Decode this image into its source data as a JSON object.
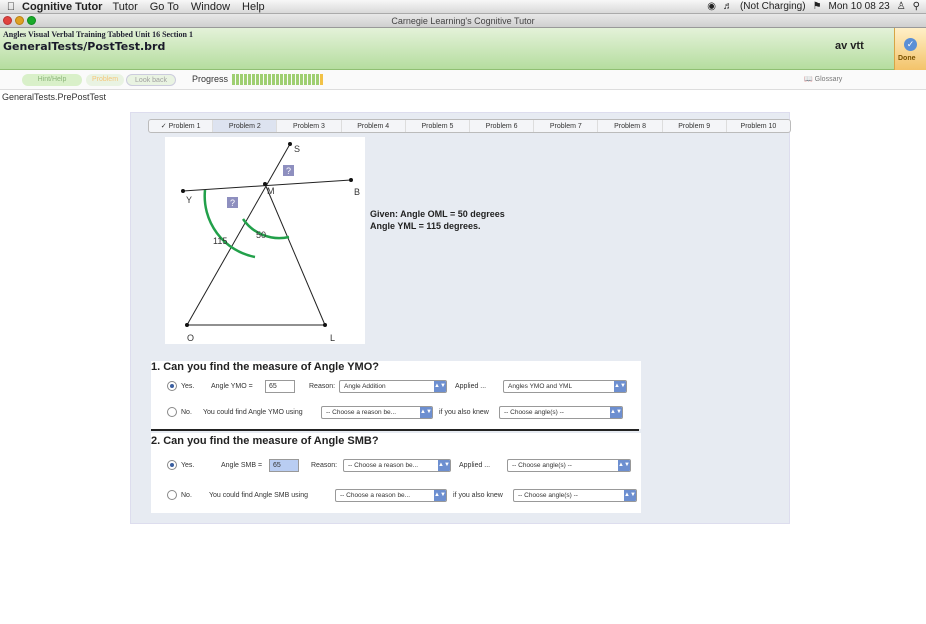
{
  "menubar": {
    "app_name": "Cognitive Tutor",
    "menus": [
      "Tutor",
      "Go To",
      "Window",
      "Help"
    ],
    "battery": "(Not Charging)",
    "clock": "Mon 10 08 23"
  },
  "window": {
    "title": "Carnegie Learning's Cognitive Tutor"
  },
  "header": {
    "unit": "Angles Visual Verbal Training Tabbed   Unit 16 Section 1",
    "file": "GeneralTests/PostTest.brd",
    "user": "av vtt",
    "done": "Done"
  },
  "toolbar": {
    "btn1": "Hint/Help",
    "btn2": "Problem",
    "btn3": "Look back",
    "progress_label": "Progress",
    "progress_value": 1.0,
    "glossary": "Glossary"
  },
  "path": "GeneralTests.PrePostTest",
  "tabs": [
    {
      "label": "Problem 1",
      "done": true,
      "check": "✓"
    },
    {
      "label": "Problem 2",
      "active": true
    },
    {
      "label": "Problem 3"
    },
    {
      "label": "Problem 4"
    },
    {
      "label": "Problem 5"
    },
    {
      "label": "Problem 6"
    },
    {
      "label": "Problem 7"
    },
    {
      "label": "Problem 8"
    },
    {
      "label": "Problem 9"
    },
    {
      "label": "Problem 10"
    }
  ],
  "figure": {
    "points": {
      "S": "S",
      "M": "M",
      "B": "B",
      "Y": "Y",
      "O": "O",
      "L": "L"
    },
    "angle_115": "115",
    "angle_50": "50",
    "unknown": "?"
  },
  "given": {
    "line1": "Given: Angle OML = 50 degrees",
    "line2": "Angle YML = 115 degrees."
  },
  "q1": {
    "title": "1. Can you find the measure of Angle YMO?",
    "yes": "Yes.",
    "angle_label": "Angle YMO =",
    "angle_value": "65",
    "reason_label": "Reason:",
    "reason_value": "Angle Addition",
    "applied_label": "Applied ...",
    "applied_value": "Angles YMO and YML",
    "no": "No.",
    "no_text": "You could find Angle YMO using",
    "no_reason": "-- Choose a reason be...",
    "no_knew": "if you also knew",
    "no_angles": "-- Choose angle(s) --"
  },
  "q2": {
    "title": "2. Can you find the measure of Angle SMB?",
    "yes": "Yes.",
    "angle_label": "Angle SMB =",
    "angle_value": "65",
    "reason_label": "Reason:",
    "reason_value": "-- Choose a reason be...",
    "applied_label": "Applied ...",
    "applied_value": "-- Choose angle(s) --",
    "no": "No.",
    "no_text": "You could find Angle SMB using",
    "no_reason": "-- Choose a reason be...",
    "no_knew": "if you also knew",
    "no_angles": "-- Choose angle(s) --"
  },
  "colors": {
    "header_green": "#b5dd9f",
    "accent_blue": "#6d8fd0",
    "arc_green": "#22a04a"
  }
}
